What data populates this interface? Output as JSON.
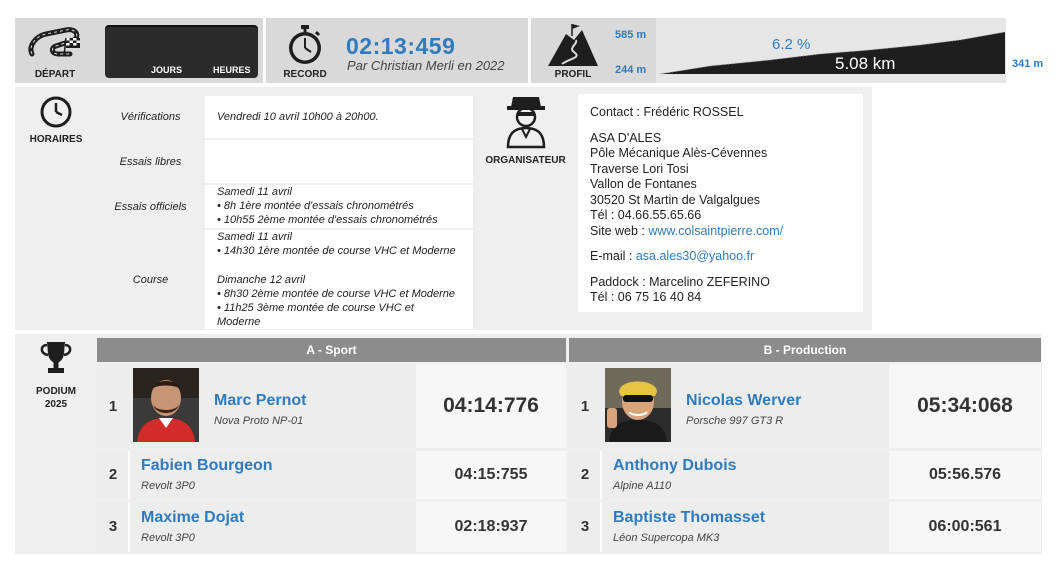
{
  "header": {
    "depart_label": "DÉPART",
    "countdown": {
      "jours_label": "JOURS",
      "heures_label": "HEURES"
    },
    "record_label": "RECORD",
    "record_time": "02:13:459",
    "record_by": "Par Christian Merli en 2022",
    "profil_label": "PROFIL",
    "profile": {
      "alt_top": "585 m",
      "alt_bottom": "244 m",
      "alt_end": "341 m",
      "gradient": "6.2 %",
      "length": "5.08 km",
      "fill_color": "#1e1e1e"
    }
  },
  "horaires": {
    "label": "HORAIRES",
    "rows": [
      {
        "label": "Vérifications",
        "lines": [
          "Vendredi 10 avril 10h00 à 20h00."
        ]
      },
      {
        "label": "Essais libres",
        "lines": []
      },
      {
        "label": "Essais officiels",
        "lines": [
          "Samedi 11 avril",
          "• 8h 1ère montée d'essais chronométrés",
          "• 10h55 2ème montée d'essais chronométrés"
        ]
      },
      {
        "label": "Course",
        "lines": [
          "Samedi 11 avril",
          "• 14h30 1ère montée de course VHC et Moderne",
          "",
          "Dimanche 12 avril",
          "• 8h30 2ème montée de course VHC et Moderne",
          "• 11h25 3ème montée de course VHC et",
          "Moderne"
        ]
      }
    ]
  },
  "organisateur": {
    "label": "ORGANISATEUR",
    "contact": "Contact : Frédéric ROSSEL",
    "address_lines": [
      "ASA D'ALES",
      "Pôle Mécanique Alès-Cévennes",
      "Traverse Lori Tosi",
      "Vallon de Fontanes",
      "30520 St Martin de Valgalgues",
      "Tél : 04.66.55.65.66"
    ],
    "site_prefix": "Site web : ",
    "site_link": "www.colsaintpierre.com/",
    "email_prefix": "E-mail : ",
    "email_link": "asa.ales30@yahoo.fr",
    "paddock": "Paddock : Marcelino ZEFERINO",
    "paddock_tel": "Tél : 06 75 16 40 84"
  },
  "podium": {
    "label_line1": "PODIUM",
    "label_line2": "2025",
    "categories": [
      {
        "title": "A - Sport",
        "entries": [
          {
            "rank": "1",
            "driver": "Marc Pernot",
            "car": "Nova Proto NP-01",
            "time": "04:14:776"
          },
          {
            "rank": "2",
            "driver": "Fabien Bourgeon",
            "car": "Revolt 3P0",
            "time": "04:15:755"
          },
          {
            "rank": "3",
            "driver": "Maxime Dojat",
            "car": "Revolt 3P0",
            "time": "02:18:937"
          }
        ]
      },
      {
        "title": "B - Production",
        "entries": [
          {
            "rank": "1",
            "driver": "Nicolas Werver",
            "car": "Porsche 997 GT3 R",
            "time": "05:34:068"
          },
          {
            "rank": "2",
            "driver": "Anthony Dubois",
            "car": "Alpine A110",
            "time": "05:56.576"
          },
          {
            "rank": "3",
            "driver": "Baptiste Thomasset",
            "car": "Léon Supercopa MK3",
            "time": "06:00:561"
          }
        ]
      }
    ]
  },
  "colors": {
    "accent": "#2e7bbf",
    "panel": "#d9d9d9",
    "header_grey": "#8c8c8c"
  }
}
